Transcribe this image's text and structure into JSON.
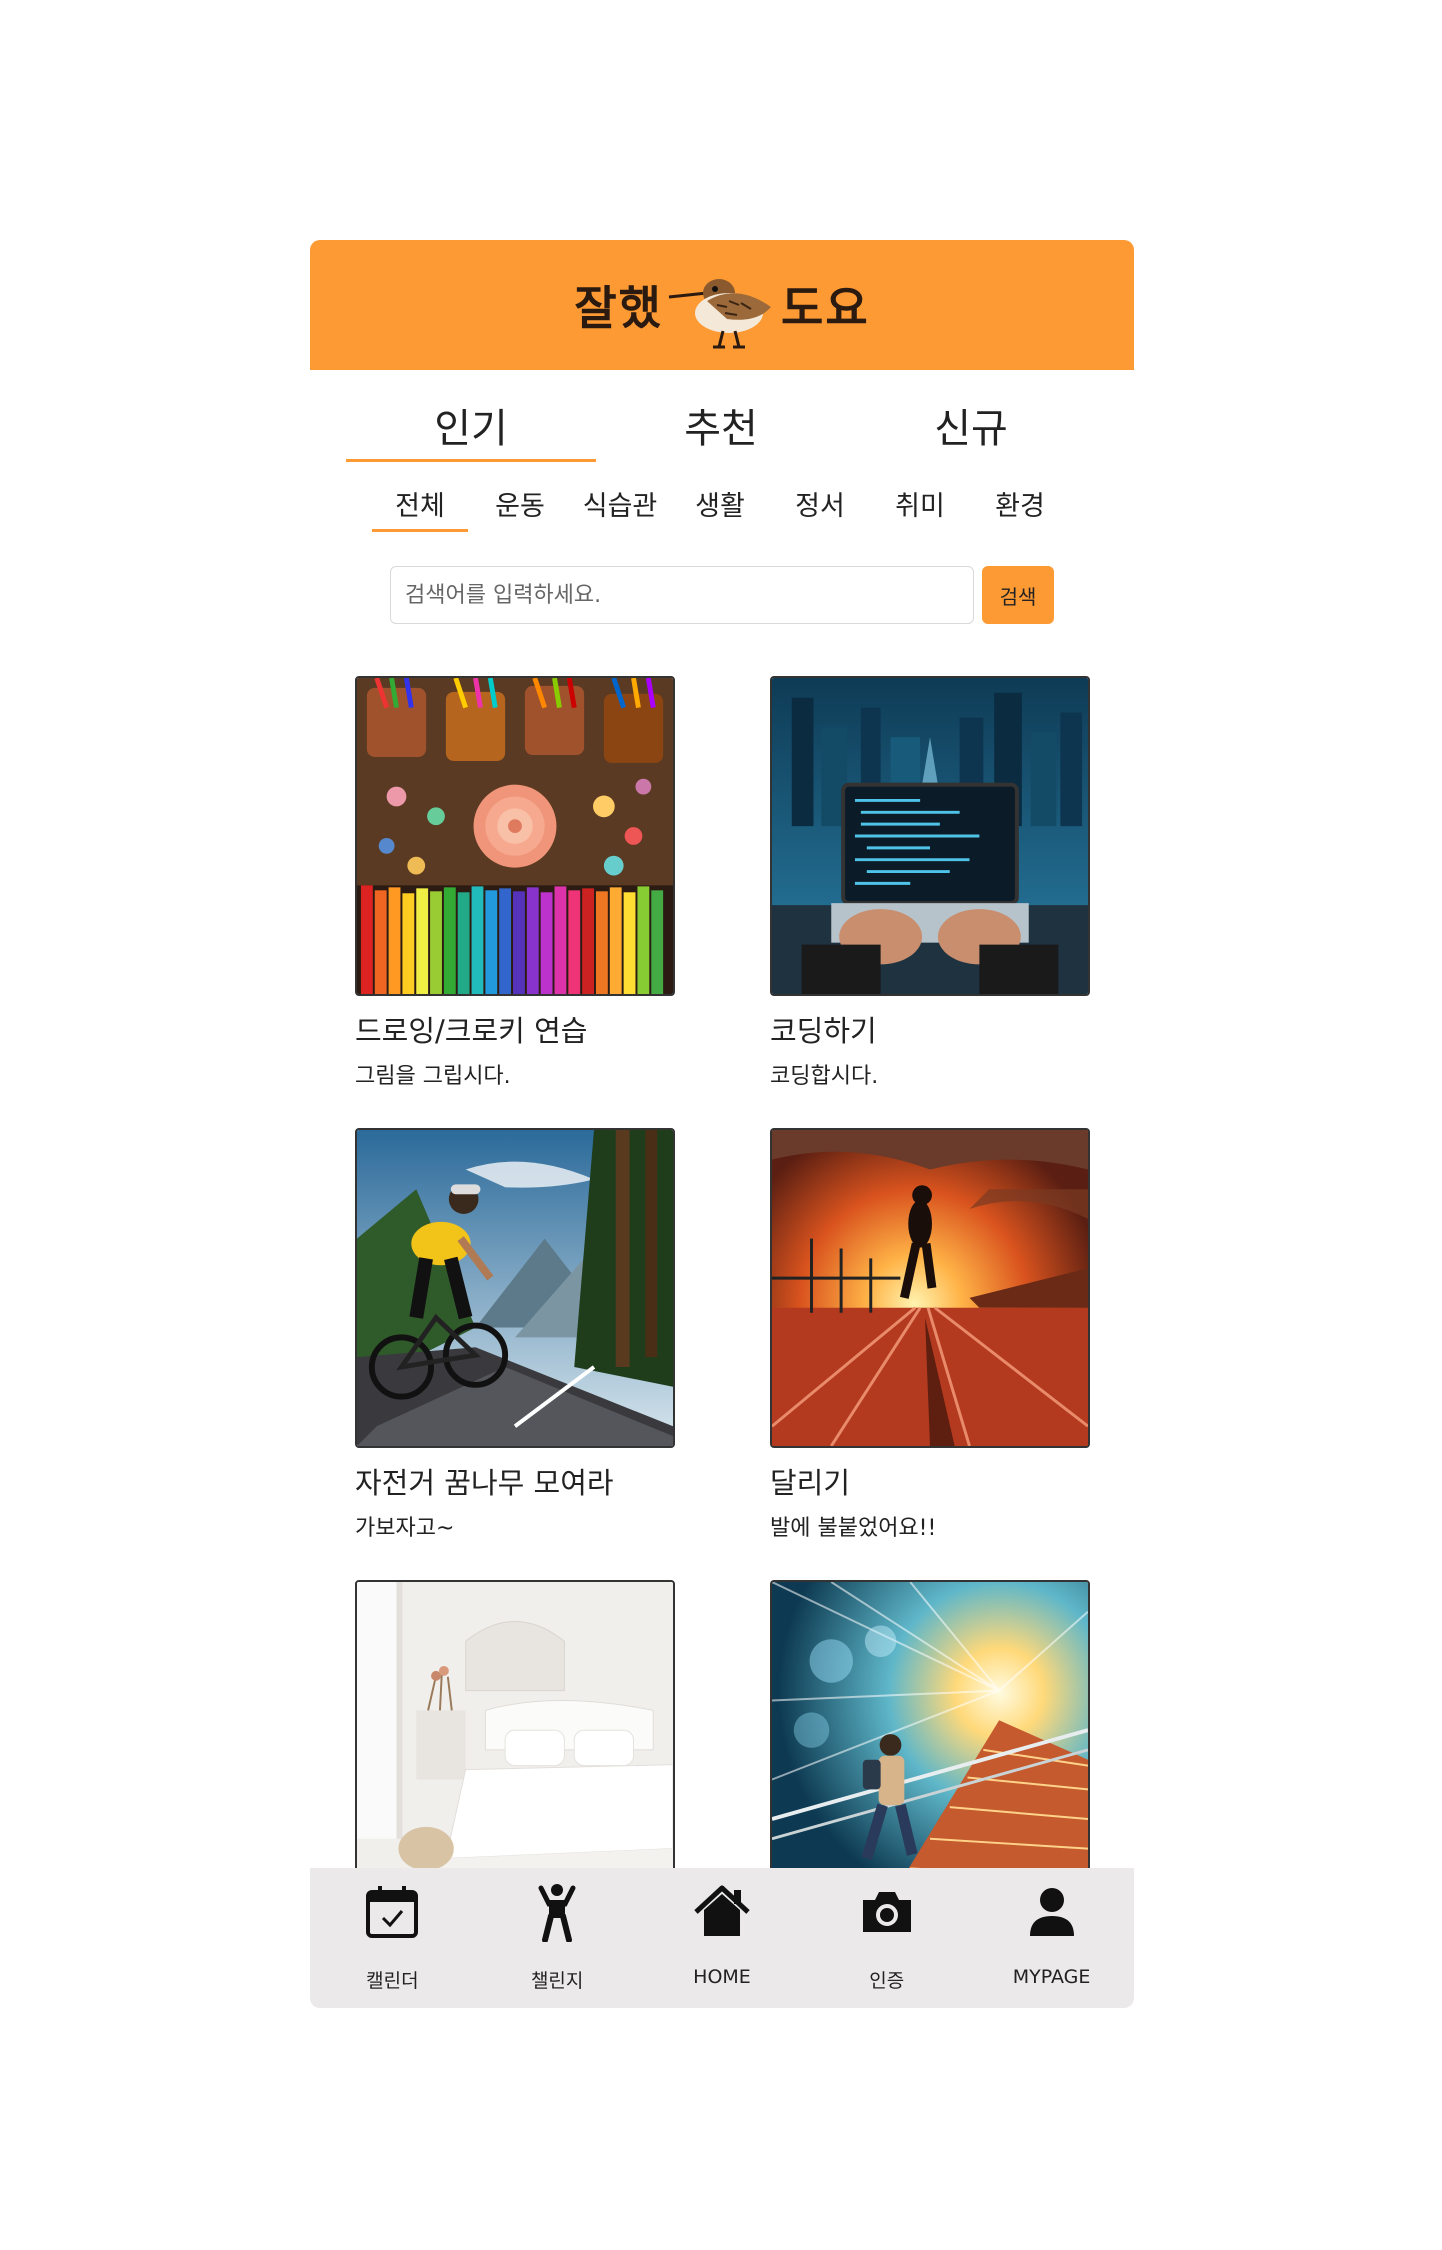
{
  "header": {
    "logo_left": "잘했",
    "logo_right": "도요",
    "brand_color": "#fd9a33"
  },
  "main_tabs": [
    {
      "label": "인기",
      "active": true
    },
    {
      "label": "추천",
      "active": false
    },
    {
      "label": "신규",
      "active": false
    }
  ],
  "sub_tabs": [
    {
      "label": "전체",
      "active": true
    },
    {
      "label": "운동",
      "active": false
    },
    {
      "label": "식습관",
      "active": false
    },
    {
      "label": "생활",
      "active": false
    },
    {
      "label": "정서",
      "active": false
    },
    {
      "label": "취미",
      "active": false
    },
    {
      "label": "환경",
      "active": false
    }
  ],
  "search": {
    "placeholder": "검색어를 입력하세요.",
    "button_label": "검색"
  },
  "cards": [
    {
      "title": "드로잉/크로키 연습",
      "desc": "그림을 그립시다."
    },
    {
      "title": "코딩하기",
      "desc": "코딩합시다."
    },
    {
      "title": "자전거 꿈나무 모여라",
      "desc": "가보자고~"
    },
    {
      "title": "달리기",
      "desc": "발에 불붙었어요!!"
    },
    {
      "title": "",
      "desc": ""
    },
    {
      "title": "",
      "desc": ""
    }
  ],
  "bottom_nav": [
    {
      "label": "캘린더",
      "icon": "calendar-check-icon"
    },
    {
      "label": "챌린지",
      "icon": "person-challenge-icon"
    },
    {
      "label": "HOME",
      "icon": "home-icon"
    },
    {
      "label": "인증",
      "icon": "camera-icon"
    },
    {
      "label": "MYPAGE",
      "icon": "user-icon"
    }
  ]
}
